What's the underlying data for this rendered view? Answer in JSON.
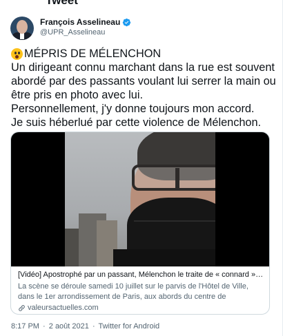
{
  "header": {
    "title": "Tweet"
  },
  "author": {
    "display_name": "François Asselineau",
    "handle": "@UPR_Asselineau",
    "verified": true
  },
  "tweet": {
    "text": "MÉPRIS DE MÉLENCHON\nUn dirigeant connu marchant dans la rue est souvent abordé par des passants voulant lui serrer la main ou être pris en photo avec lui.\nPersonnellement, j'y donne toujours mon accord.\nJe suis héberlué par cette violence de Mélenchon.",
    "emoji": "astonished-face-emoji"
  },
  "card": {
    "title": "[Vidéo] Apostrophé par un passant, Mélenchon le traite de « connard » et ordo...",
    "description": "La scène se déroule samedi 10 juillet sur le parvis de l'Hôtel de Ville, dans le 1er arrondissement de Paris, aux abords du centre de vaccination éphémère, installé...",
    "domain": "valeursactuelles.com"
  },
  "meta": {
    "time": "8:17 PM",
    "separator": "·",
    "date": "2 août 2021",
    "source": "Twitter for Android"
  },
  "colors": {
    "text": "#0f1419",
    "secondary": "#536471",
    "border": "#cfd9de",
    "verified": "#1d9bf0"
  }
}
